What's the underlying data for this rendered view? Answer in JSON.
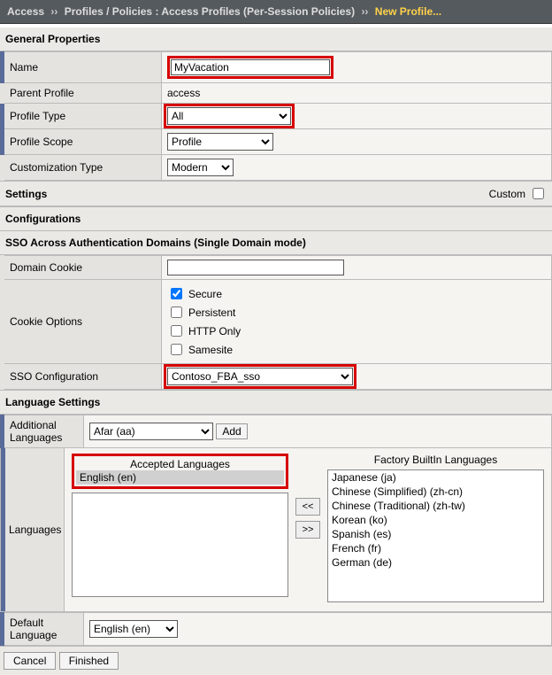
{
  "breadcrumb": {
    "root": "Access",
    "path": "Profiles / Policies : Access Profiles (Per-Session Policies)",
    "current": "New Profile..."
  },
  "sections": {
    "general": "General Properties",
    "settings": "Settings",
    "custom_label": "Custom",
    "configurations": "Configurations",
    "sso_header": "SSO Across Authentication Domains (Single Domain mode)",
    "language": "Language Settings"
  },
  "general": {
    "name_label": "Name",
    "name_value": "MyVacation",
    "parent_label": "Parent Profile",
    "parent_value": "access",
    "type_label": "Profile Type",
    "type_value": "All",
    "scope_label": "Profile Scope",
    "scope_value": "Profile",
    "cust_label": "Customization Type",
    "cust_value": "Modern"
  },
  "sso": {
    "domain_cookie_label": "Domain Cookie",
    "domain_cookie_value": "",
    "cookie_opts_label": "Cookie Options",
    "opt_secure": "Secure",
    "opt_persistent": "Persistent",
    "opt_httponly": "HTTP Only",
    "opt_samesite": "Samesite",
    "sso_conf_label": "SSO Configuration",
    "sso_conf_value": "Contoso_FBA_sso"
  },
  "lang": {
    "add_label": "Additional Languages",
    "add_select": "Afar (aa)",
    "add_btn": "Add",
    "languages_label": "Languages",
    "accepted_title": "Accepted Languages",
    "accepted_items": [
      "English (en)"
    ],
    "factory_title": "Factory BuiltIn Languages",
    "factory_items": [
      "Japanese (ja)",
      "Chinese (Simplified) (zh-cn)",
      "Chinese (Traditional) (zh-tw)",
      "Korean (ko)",
      "Spanish (es)",
      "French (fr)",
      "German (de)"
    ],
    "move_left": "<<",
    "move_right": ">>",
    "default_label": "Default Language",
    "default_value": "English (en)"
  },
  "footer": {
    "cancel": "Cancel",
    "finished": "Finished"
  }
}
